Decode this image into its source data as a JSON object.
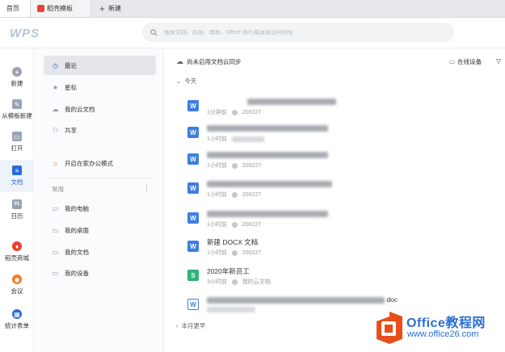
{
  "tabs": [
    {
      "label": "首页"
    },
    {
      "label": "稻壳模板"
    },
    {
      "label": "新建"
    }
  ],
  "header": {
    "logo_text": "WPS",
    "search_placeholder": "搜索文档、应用、模板、Office 技巧或直接访问网址"
  },
  "leftnav": {
    "items": [
      {
        "label": "新建",
        "icon": "plus-circle-icon",
        "color": "#9aa3b5"
      },
      {
        "label": "从模板新建",
        "icon": "template-icon",
        "color": "#9aa3b5"
      },
      {
        "label": "打开",
        "icon": "folder-icon",
        "color": "#9aa3b5"
      },
      {
        "label": "文档",
        "icon": "document-icon",
        "color": "#2d6bd6"
      },
      {
        "label": "日历",
        "icon": "calendar-icon",
        "color": "#9aa3b5"
      },
      {
        "label": "稻壳商城",
        "icon": "docer-icon",
        "color": "#e8432d"
      },
      {
        "label": "会议",
        "icon": "meeting-icon",
        "color": "#f07a2b"
      },
      {
        "label": "统计表单",
        "icon": "form-icon",
        "color": "#2d6bd6"
      }
    ]
  },
  "sidebar": {
    "items": [
      {
        "label": "最近",
        "icon": "clock-icon"
      },
      {
        "label": "星标",
        "icon": "star-icon"
      },
      {
        "label": "我的云文档",
        "icon": "cloud-icon"
      },
      {
        "label": "共享",
        "icon": "share-icon"
      },
      {
        "label": "开启在家办公模式",
        "icon": "home-office-icon"
      }
    ],
    "section_label": "常用",
    "common": [
      {
        "label": "我的电脑",
        "icon": "computer-icon"
      },
      {
        "label": "我的桌面",
        "icon": "desktop-icon"
      },
      {
        "label": "我的文档",
        "icon": "my-docs-icon"
      },
      {
        "label": "我的设备",
        "icon": "device-icon"
      }
    ]
  },
  "main": {
    "sync_text": "尚未启用文档云同步",
    "device_label": "在线设备",
    "group_today": "今天",
    "group_month": "本月更早",
    "files": [
      {
        "name": "",
        "time": "1分钟前",
        "location": "200227",
        "type": "W",
        "color": "#3d7fe0"
      },
      {
        "name": "",
        "time": "1小时前",
        "location": "",
        "type": "W",
        "color": "#3d7fe0"
      },
      {
        "name": "",
        "time": "1小时前",
        "location": "200227",
        "type": "W",
        "color": "#3d7fe0"
      },
      {
        "name": "",
        "time": "1小时前",
        "location": "200227",
        "type": "W",
        "color": "#3d7fe0"
      },
      {
        "name": "",
        "time": "1小时前",
        "location": "200227",
        "type": "W",
        "color": "#3d7fe0"
      },
      {
        "name": "新建 DOCX 文档",
        "time": "1小时前",
        "location": "200227",
        "type": "W",
        "color": "#3d7fe0"
      },
      {
        "name": "2020年新员工",
        "time": "3小时前",
        "location": "我的云文档",
        "type": "S",
        "color": "#2bb37a"
      },
      {
        "name": "doc",
        "time": "",
        "location": "",
        "type": "W",
        "color": "#ffffff"
      }
    ]
  },
  "watermark": {
    "title": "Office教程网",
    "url": "www.office26.com"
  }
}
